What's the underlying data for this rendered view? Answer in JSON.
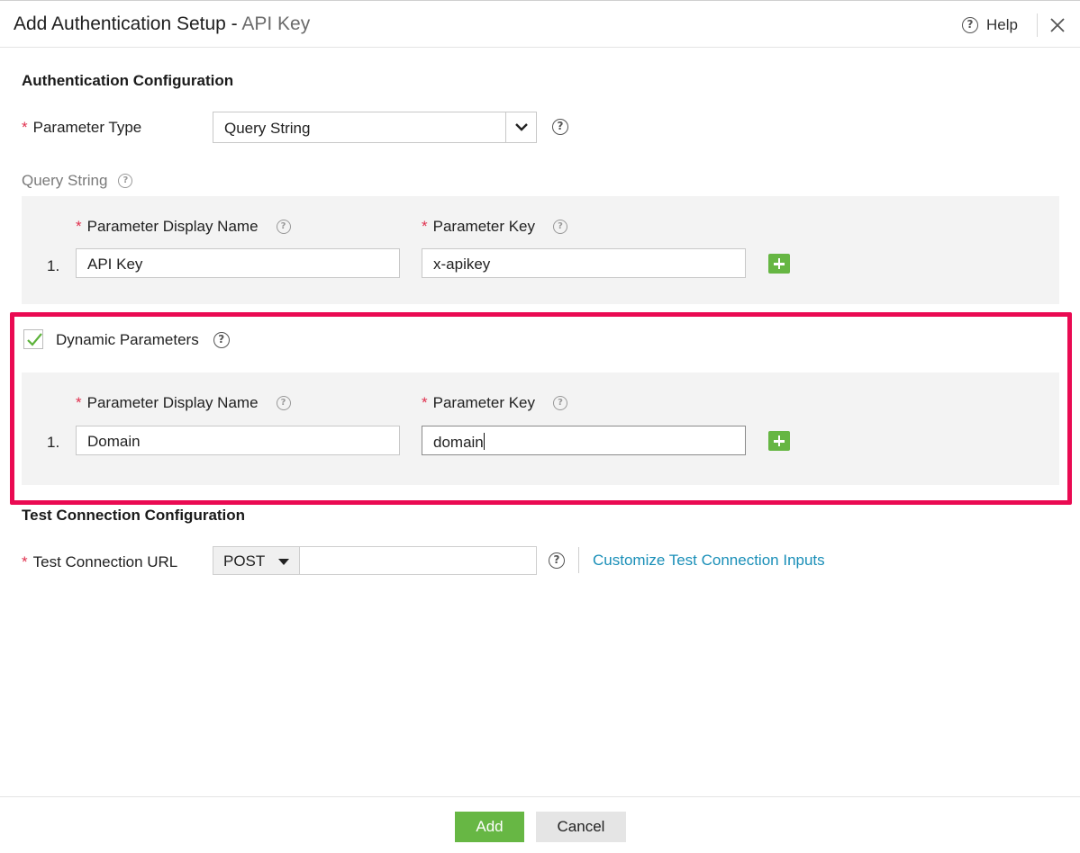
{
  "header": {
    "title": "Add Authentication Setup - ",
    "subtitle": "API Key",
    "help_label": "Help"
  },
  "auth_config": {
    "section_title": "Authentication Configuration",
    "param_type_label": "Parameter Type",
    "param_type_value": "Query String",
    "query_string_label": "Query String",
    "columns": {
      "display_name": "Parameter Display Name",
      "key": "Parameter Key"
    },
    "rows": [
      {
        "num": "1.",
        "display_name": "API Key",
        "key": "x-apikey"
      }
    ]
  },
  "dynamic": {
    "checkbox_label": "Dynamic Parameters",
    "checked": true,
    "columns": {
      "display_name": "Parameter Display Name",
      "key": "Parameter Key"
    },
    "rows": [
      {
        "num": "1.",
        "display_name": "Domain",
        "key": "domain"
      }
    ]
  },
  "test_connection": {
    "section_title": "Test Connection Configuration",
    "url_label": "Test Connection URL",
    "method": "POST",
    "url_value": "",
    "customize_link": "Customize Test Connection Inputs"
  },
  "footer": {
    "add_label": "Add",
    "cancel_label": "Cancel"
  },
  "colors": {
    "accent_green": "#67b744",
    "required": "#e0304e",
    "highlight": "#ea0a52",
    "link": "#1a8fb8"
  },
  "icons": [
    "help-icon",
    "close-icon",
    "chevron-down-icon",
    "add-row-icon",
    "checkmark-icon",
    "caret-down-icon"
  ]
}
